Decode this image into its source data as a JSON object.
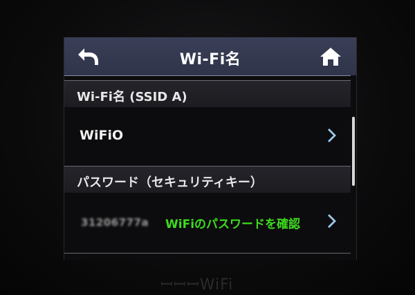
{
  "header": {
    "title": "Wi-Fi名",
    "back_icon": "back-arrow-icon",
    "home_icon": "home-icon"
  },
  "sections": [
    {
      "title": "Wi-Fi名 (SSID A)",
      "row_label": "WiFiO"
    },
    {
      "title": "パスワード（セキュリティキー）",
      "row_value": "31206777a",
      "row_action": "WiFiのパスワードを確認"
    }
  ],
  "device_brand": "ꟷꟷꟷWiFi",
  "colors": {
    "header_bg": "#343950",
    "accent_green": "#3ddc1e",
    "chevron": "#9cc7e6"
  }
}
